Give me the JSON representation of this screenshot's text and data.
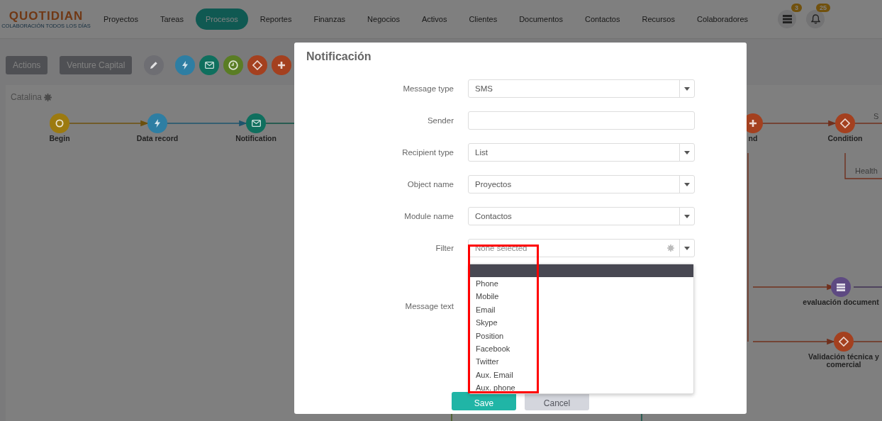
{
  "navbar": {
    "logo": "QUOTIDIAN",
    "tagline": "COLABORACIÓN TODOS LOS DÍAS",
    "items": [
      {
        "label": "Proyectos",
        "selected": false
      },
      {
        "label": "Tareas",
        "selected": false
      },
      {
        "label": "Procesos",
        "selected": true
      },
      {
        "label": "Reportes",
        "selected": false
      },
      {
        "label": "Finanzas",
        "selected": false
      },
      {
        "label": "Negocios",
        "selected": false
      },
      {
        "label": "Activos",
        "selected": false
      },
      {
        "label": "Clientes",
        "selected": false
      },
      {
        "label": "Documentos",
        "selected": false
      },
      {
        "label": "Contactos",
        "selected": false
      },
      {
        "label": "Recursos",
        "selected": false
      },
      {
        "label": "Colaboradores",
        "selected": false
      }
    ],
    "badges": [
      {
        "kind": "list",
        "count": "3"
      },
      {
        "kind": "bell",
        "count": "25"
      }
    ]
  },
  "toolbar": {
    "buttons": [
      "Actions",
      "Venture Capital"
    ],
    "tools": [
      {
        "kind": "edit",
        "color": "#6e6e73"
      },
      {
        "kind": "bolt",
        "color": "#2e7ea3"
      },
      {
        "kind": "mail",
        "color": "#0f6f5e"
      },
      {
        "kind": "clock",
        "color": "#5a7d24"
      },
      {
        "kind": "diamond",
        "color": "#a4401f"
      },
      {
        "kind": "plus",
        "color": "#a4401f"
      }
    ]
  },
  "canvas": {
    "title": "Catalina",
    "nodes": [
      {
        "label": "Begin",
        "kind": "circle",
        "color": "#9c7a10"
      },
      {
        "label": "Data record",
        "kind": "bolt",
        "color": "#2e7ea3"
      },
      {
        "label": "Notification",
        "kind": "mail",
        "color": "#0f6f5e"
      },
      {
        "label": "nd",
        "kind": "plus",
        "color": "#a4401f"
      },
      {
        "label": "Condition",
        "kind": "diamond",
        "color": "#a4401f"
      },
      {
        "label": "evaluación document",
        "kind": "list",
        "color": "#5e4a82"
      },
      {
        "label": "Validación técnica y comercial",
        "kind": "diamond",
        "color": "#a4401f"
      }
    ],
    "edge_labels": [
      "S",
      "Health"
    ]
  },
  "modal": {
    "title": "Notificación",
    "fields": [
      {
        "label": "Message type",
        "kind": "select",
        "value": "SMS"
      },
      {
        "label": "Sender",
        "kind": "text"
      },
      {
        "label": "Recipient type",
        "kind": "select",
        "value": "List"
      },
      {
        "label": "Object name",
        "kind": "select",
        "value": "Proyectos"
      },
      {
        "label": "Module name",
        "kind": "select",
        "value": "Contactos"
      },
      {
        "label": "Filter",
        "kind": "multiselect",
        "placeholder": "None selected"
      },
      {
        "label": "Message text",
        "kind": "textarea"
      }
    ],
    "dropdown": {
      "options": [
        "Phone",
        "Mobile",
        "Email",
        "Skype",
        "Position",
        "Facebook",
        "Twitter",
        "Aux. Email",
        "Aux. phone"
      ]
    },
    "buttons": [
      {
        "label": "Save",
        "kind": "primary"
      },
      {
        "label": "Cancel",
        "kind": "secondary"
      }
    ]
  }
}
